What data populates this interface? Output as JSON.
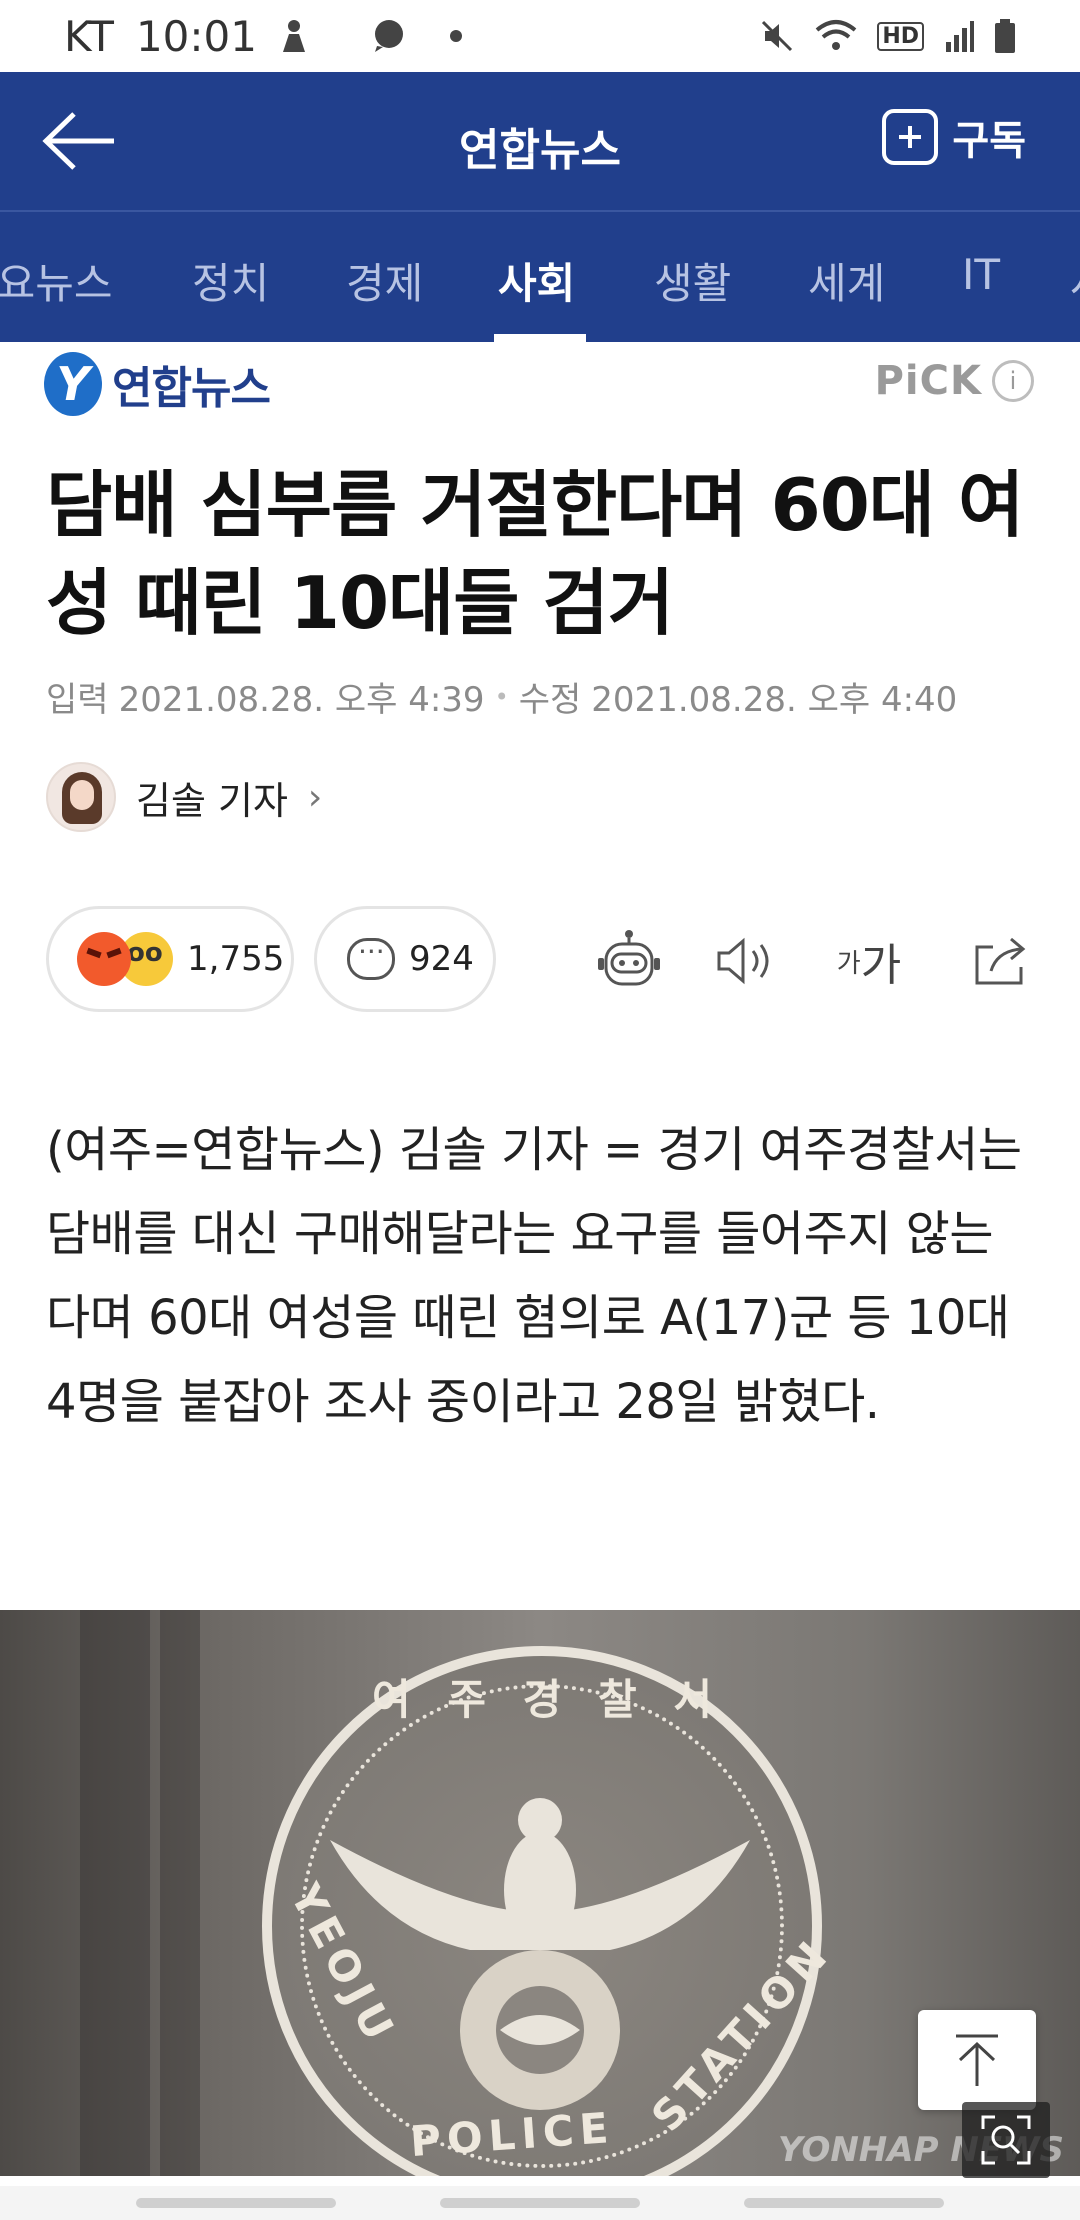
{
  "status_bar": {
    "carrier": "KT",
    "time": "10:01",
    "hd_label": "HD"
  },
  "app_bar": {
    "title": "연합뉴스",
    "subscribe_label": "구독"
  },
  "tabs": [
    {
      "label": "주요뉴스"
    },
    {
      "label": "정치"
    },
    {
      "label": "경제"
    },
    {
      "label": "사회"
    },
    {
      "label": "생활"
    },
    {
      "label": "세계"
    },
    {
      "label": "IT"
    },
    {
      "label": "사설"
    }
  ],
  "publisher": {
    "logo_letter": "Y",
    "name": "연합뉴스",
    "pick_label": "PiCK",
    "info_label": "i"
  },
  "article": {
    "headline": "담배 심부름 거절한다며 60대 여성 때린 10대들 검거",
    "input_label": "입력",
    "input_date": "2021.08.28. 오후 4:39",
    "edit_label": "수정",
    "edit_date": "2021.08.28. 오후 4:40",
    "author": "김솔 기자",
    "body": "(여주=연합뉴스) 김솔 기자 = 경기 여주경찰서는 담배를 대신 구매해달라는 요구를 들어주지 않는다며 60대 여성을 때린 혐의로 A(17)군 등 10대 4명을 붙잡아 조사 중이라고 28일 밝혔다."
  },
  "actions": {
    "reaction_count": "1,755",
    "comment_count": "924",
    "font_small": "가",
    "font_large": "가"
  },
  "photo": {
    "seal_ko": [
      "여",
      "주",
      "경",
      "찰",
      "서"
    ],
    "seal_en_1": "YEOJU",
    "seal_en_2": "POLICE",
    "seal_en_3": "STATION",
    "watermark": "YONHAP NEWS"
  },
  "colors": {
    "brand_blue": "#213f8c",
    "angry": "#f25a2c",
    "glasses": "#f7c93a"
  }
}
